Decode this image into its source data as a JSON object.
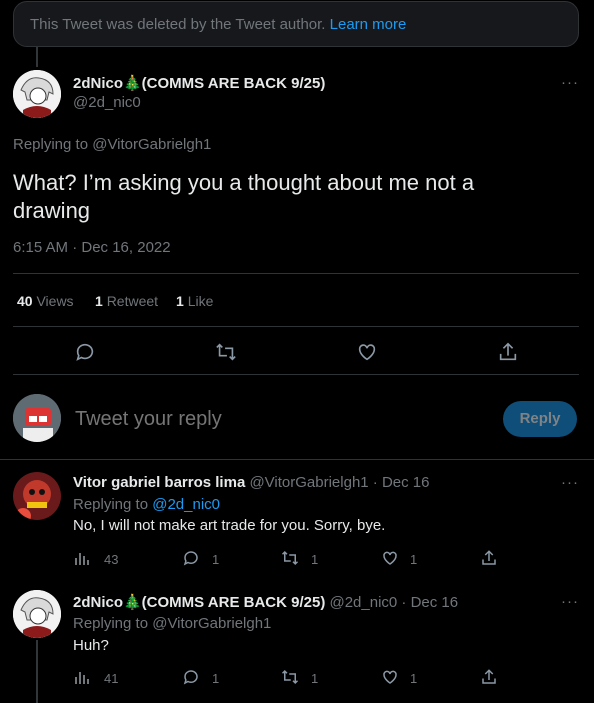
{
  "deleted_notice": {
    "text": "This Tweet was deleted by the Tweet author.",
    "link": "Learn more"
  },
  "main_tweet": {
    "display_name": "2dNico🎄(COMMS ARE BACK 9/25)",
    "handle": "@2d_nic0",
    "replying_prefix": "Replying to",
    "replying_to": "@VitorGabrielgh1",
    "text": "What? I’m asking you a thought about me not a drawing",
    "timestamp": "6:15 AM · Dec 16, 2022",
    "stats": {
      "views_count": "40",
      "views_label": "Views",
      "retweets_count": "1",
      "retweets_label": "Retweet",
      "likes_count": "1",
      "likes_label": "Like"
    }
  },
  "reply_composer": {
    "placeholder": "Tweet your reply",
    "button": "Reply"
  },
  "replies": [
    {
      "display_name": "Vitor gabriel barros lima",
      "handle_date": "@VitorGabrielgh1 · Dec 16",
      "replying_prefix": "Replying to",
      "replying_to": "@2d_nic0",
      "text": "No, I will not make art trade for you. Sorry, bye.",
      "views": "43",
      "replies": "1",
      "retweets": "1",
      "likes": "1"
    },
    {
      "display_name": "2dNico🎄(COMMS ARE BACK 9/25)",
      "handle_date": "@2d_nic0 · Dec 16",
      "replying_prefix": "Replying to",
      "replying_to": "@VitorGabrielgh1",
      "text": "Huh?",
      "views": "41",
      "replies": "1",
      "retweets": "1",
      "likes": "1"
    }
  ],
  "icons": {
    "reply": "reply-icon",
    "retweet": "retweet-icon",
    "like": "heart-icon",
    "share": "share-icon",
    "views": "views-icon",
    "more": "more-icon"
  },
  "colors": {
    "background": "#000000",
    "accent": "#1d9bf0",
    "muted": "#71767b",
    "divider": "#2f3336"
  }
}
